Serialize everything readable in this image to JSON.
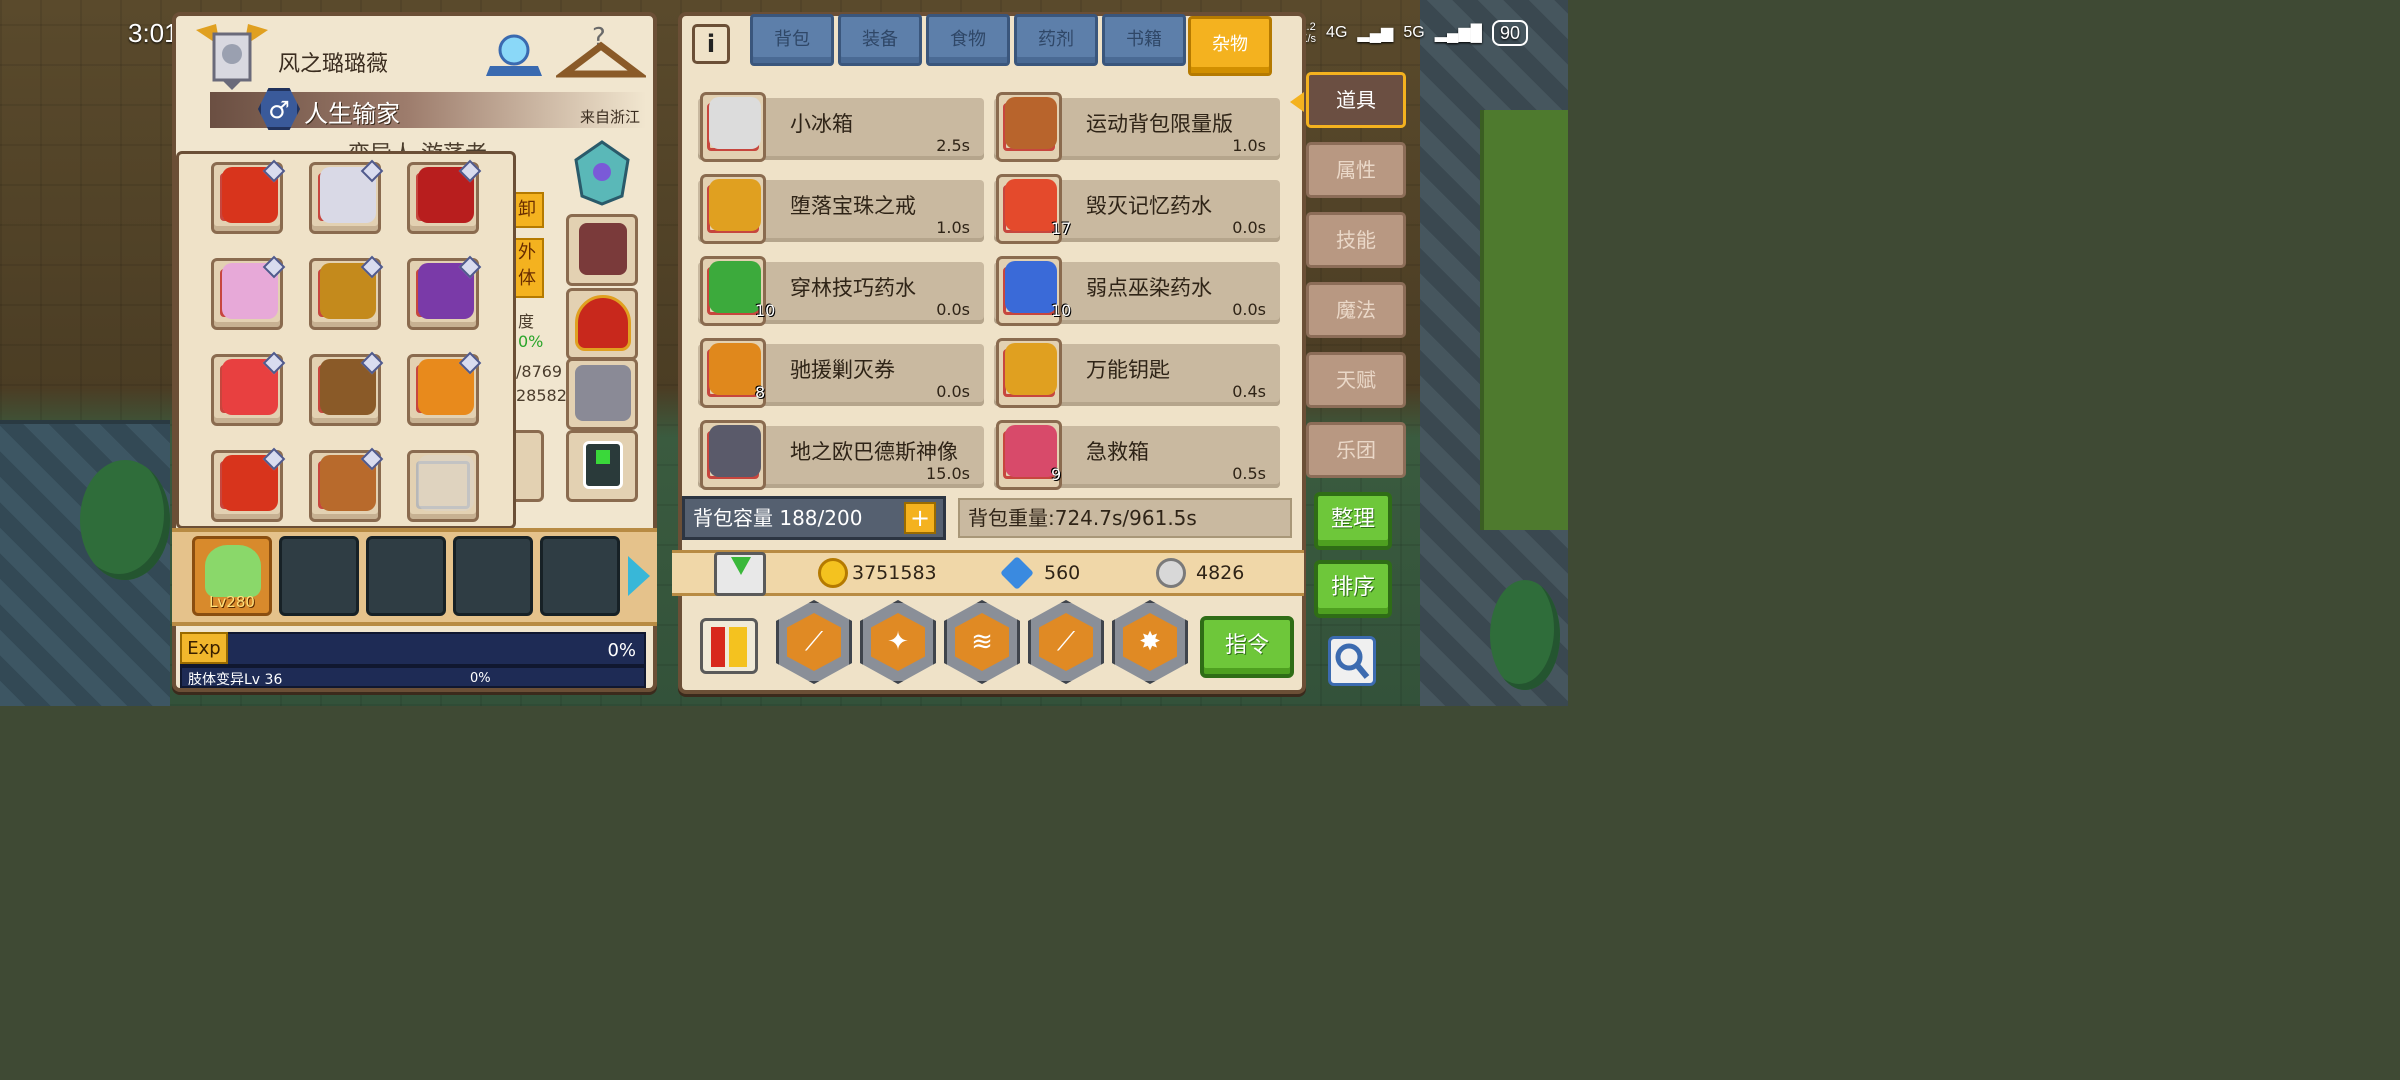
{
  "status_bar": {
    "time": "3:01",
    "speed_top": "1.2",
    "speed_bottom": "K/s",
    "net1": "4G",
    "net2": "5G",
    "battery": "90"
  },
  "character": {
    "name": "风之璐璐薇",
    "title": "人生输家",
    "gender_symbol": "♂",
    "origin": "来自浙江",
    "subtitle": "变异人 游荡者"
  },
  "left_side": {
    "unequip_label": "卸",
    "outfit_label": "外\n体",
    "stat_label": "度",
    "stat_pct": "0%",
    "hp": "/8769",
    "mp": "28582"
  },
  "accessories": [
    {
      "name": "flame-claw-item",
      "color": "#d8341c"
    },
    {
      "name": "sword-item",
      "color": "#d9d9e6"
    },
    {
      "name": "demon-mask-item",
      "color": "#b81e1e"
    },
    {
      "name": "heart-ring-item",
      "color": "#e7a9d8"
    },
    {
      "name": "serpent-ring-item",
      "color": "#c48a1c"
    },
    {
      "name": "crown-ring-item",
      "color": "#7a3aa8"
    },
    {
      "name": "rose-glove-item",
      "color": "#e84040"
    },
    {
      "name": "gauntlet-item",
      "color": "#8a5a28"
    },
    {
      "name": "pumpkin-item",
      "color": "#e88a1c"
    },
    {
      "name": "fire-boot-item",
      "color": "#d8341c"
    },
    {
      "name": "k-boot-item",
      "color": "#b86a2c"
    },
    {
      "name": "empty-slot",
      "color": "#d8d8d8"
    }
  ],
  "party": {
    "level": "Lv280"
  },
  "exp": {
    "label": "Exp",
    "value": "0%"
  },
  "skill_progress": {
    "name": "肢体变异Lv 36",
    "value": "0%"
  },
  "tabs": [
    {
      "label": "背包",
      "active": false
    },
    {
      "label": "装备",
      "active": false
    },
    {
      "label": "食物",
      "active": false
    },
    {
      "label": "药剂",
      "active": false
    },
    {
      "label": "书籍",
      "active": false
    },
    {
      "label": "杂物",
      "active": true
    }
  ],
  "items": [
    {
      "name": "小冰箱",
      "time": "2.5s",
      "qty": "",
      "icon": "fridge-icon",
      "color": "#dcdcdc"
    },
    {
      "name": "运动背包限量版",
      "time": "1.0s",
      "qty": "",
      "icon": "backpack-icon",
      "color": "#b8642c"
    },
    {
      "name": "堕落宝珠之戒",
      "time": "1.0s",
      "qty": "",
      "icon": "orb-ring-icon",
      "color": "#e0a020"
    },
    {
      "name": "毁灭记忆药水",
      "time": "0.0s",
      "qty": "17",
      "icon": "potion-red-icon",
      "color": "#e44a2c"
    },
    {
      "name": "穿林技巧药水",
      "time": "0.0s",
      "qty": "10",
      "icon": "potion-green-icon",
      "color": "#3caa3c"
    },
    {
      "name": "弱点巫染药水",
      "time": "0.0s",
      "qty": "10",
      "icon": "potion-blue-icon",
      "color": "#3a6ad8"
    },
    {
      "name": "驰援剿灭券",
      "time": "0.0s",
      "qty": "8",
      "icon": "scroll-icon",
      "color": "#e0881c"
    },
    {
      "name": "万能钥匙",
      "time": "0.4s",
      "qty": "",
      "icon": "key-icon",
      "color": "#e0a020"
    },
    {
      "name": "地之欧巴德斯神像",
      "time": "15.0s",
      "qty": "",
      "icon": "statue-icon",
      "color": "#5a5a6a"
    },
    {
      "name": "急救箱",
      "time": "0.5s",
      "qty": "9",
      "icon": "first-aid-icon",
      "color": "#d84a6a"
    }
  ],
  "capacity": {
    "label": "背包容量 188/200",
    "weight": "背包重量:724.7s/961.5s"
  },
  "currency": {
    "gold": "3751583",
    "diamond": "560",
    "silver": "4826"
  },
  "command_label": "指令",
  "categories": [
    {
      "label": "道具",
      "active": true
    },
    {
      "label": "属性",
      "active": false
    },
    {
      "label": "技能",
      "active": false
    },
    {
      "label": "魔法",
      "active": false
    },
    {
      "label": "天赋",
      "active": false
    },
    {
      "label": "乐团",
      "active": false
    }
  ],
  "buttons": {
    "organize": "整理",
    "sort": "排序"
  },
  "colors": {
    "accent": "#f4b21f",
    "green": "#6ec73a",
    "panel": "#efe2c8"
  }
}
